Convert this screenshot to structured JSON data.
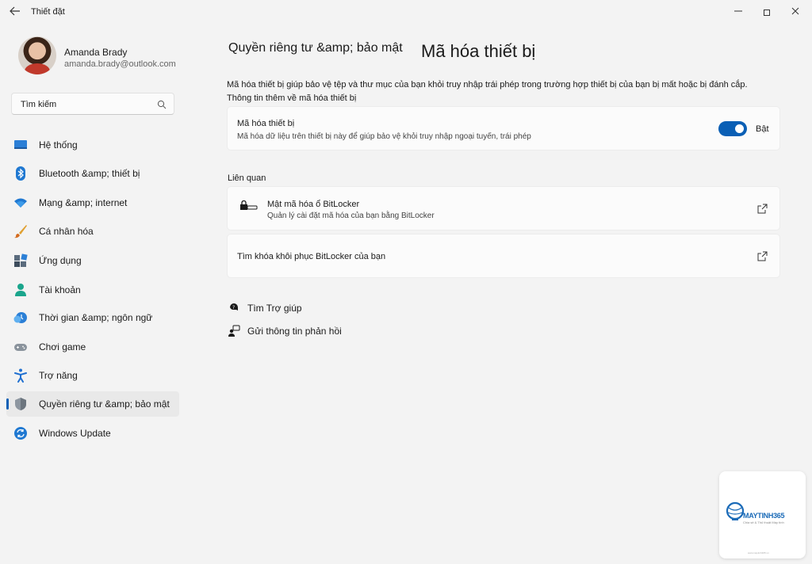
{
  "window": {
    "title": "Thiết đặt",
    "back_icon": "back-arrow-icon",
    "controls": {
      "minimize": "—",
      "close": "✕"
    }
  },
  "user": {
    "name": "Amanda Brady",
    "email": "amanda.brady@outlook.com"
  },
  "search": {
    "value": "Tìm kiếm",
    "icon": "search-icon"
  },
  "sidebar": {
    "items": [
      {
        "label": "Hệ thống",
        "icon": "system-icon"
      },
      {
        "label": "Bluetooth &amp; thiết bị",
        "icon": "bluetooth-icon"
      },
      {
        "label": "Mạng &amp; internet",
        "icon": "wifi-icon"
      },
      {
        "label": "Cá nhân hóa",
        "icon": "brush-icon"
      },
      {
        "label": "Ứng dụng",
        "icon": "apps-icon"
      },
      {
        "label": "Tài khoản",
        "icon": "account-icon"
      },
      {
        "label": "Thời gian &amp; ngôn ngữ",
        "icon": "time-language-icon"
      },
      {
        "label": "Chơi game",
        "icon": "gamepad-icon"
      },
      {
        "label": "Trợ năng",
        "icon": "accessibility-icon"
      },
      {
        "label": "Quyền riêng tư &amp; bảo mật",
        "icon": "shield-icon",
        "active": true
      },
      {
        "label": "Windows Update",
        "icon": "update-icon"
      }
    ]
  },
  "main": {
    "breadcrumb_parent": "Quyền riêng tư &amp; bảo mật",
    "page_title": "Mã hóa thiết bị",
    "description": "Mã hóa thiết bị giúp bảo vệ tệp và thư mục của bạn khỏi truy nhập trái phép trong trường hợp thiết bị của bạn bị mất hoặc bị đánh cắp.",
    "description_link": "Thông tin thêm về mã hóa thiết bị",
    "encryption_card": {
      "title": "Mã hóa thiết bị",
      "subtitle": "Mã hóa dữ liệu trên thiết bị này để giúp bảo vệ khỏi truy nhập ngoại tuyến, trái phép",
      "toggle_state": "Bật",
      "toggle_on": true
    },
    "related_label": "Liên quan",
    "related": [
      {
        "title": "Mật mã hóa ổ BitLocker",
        "subtitle": "Quản lý cài đặt mã hóa của bạn bằng BitLocker",
        "icon": "bitlocker-key-icon",
        "action_icon": "external-link-icon"
      },
      {
        "title": "Tìm khóa khôi phục BitLocker của bạn",
        "action_icon": "external-link-icon"
      }
    ],
    "help_links": [
      {
        "label": "Tìm Trợ giúp",
        "icon": "help-icon"
      },
      {
        "label": "Gửi thông tin phản hồi",
        "icon": "feedback-icon"
      }
    ]
  },
  "watermark": {
    "brand": "MAYTINH365",
    "tagline": "Chia sẻ & Thủ thuật Máy tính",
    "url": "www.maytinh365.vn"
  },
  "colors": {
    "accent": "#0a5fb5",
    "background": "#f3f3f3",
    "card": "#fbfbfb"
  }
}
